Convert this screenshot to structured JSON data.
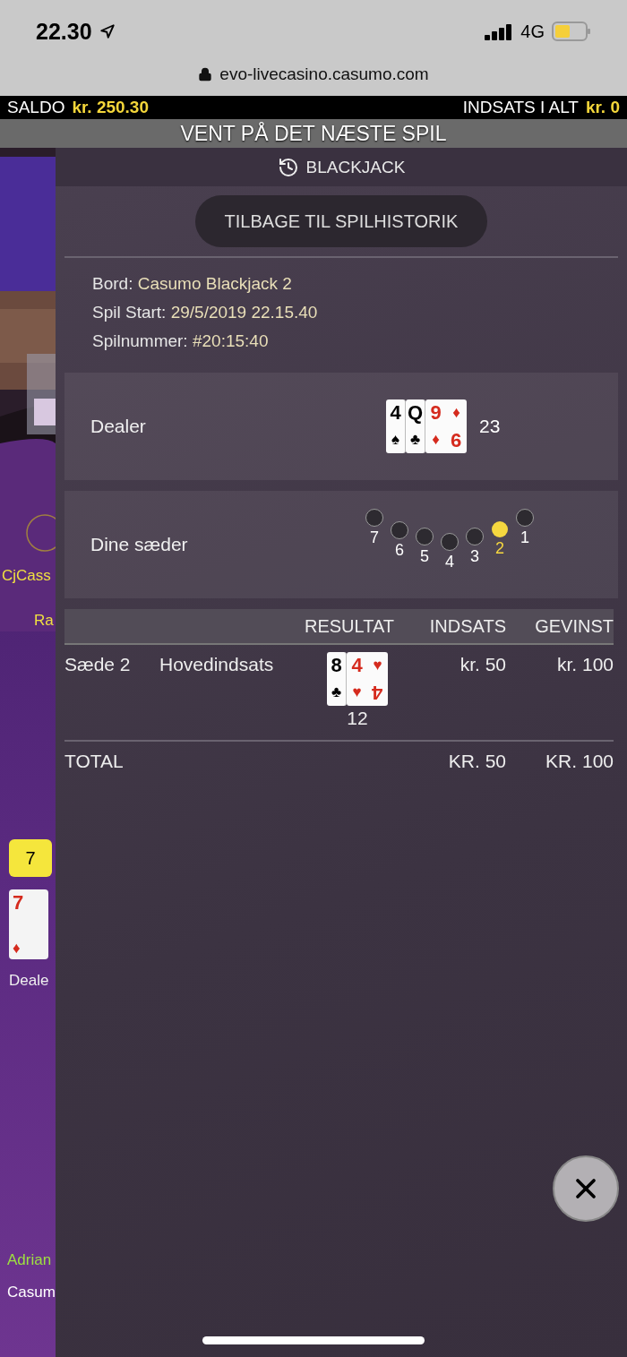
{
  "status_bar": {
    "time": "22.30",
    "network": "4G"
  },
  "browser": {
    "url": "evo-livecasino.casumo.com"
  },
  "balance_bar": {
    "balance_label": "SALDO",
    "balance": "kr. 250.30",
    "total_bet_label": "INDSATS I ALT",
    "total_bet": "kr. 0"
  },
  "banner": "VENT PÅ DET NÆSTE SPIL",
  "game_view": {
    "player_name": "CjCass",
    "player_line": "Ra",
    "dealer_score": "7",
    "dealer_card": {
      "rank": "7",
      "suit": "♦",
      "color": "#d52b1e"
    },
    "dealer_hand_label": "Deale",
    "chat_name": "Adrian",
    "table_name": "Casum"
  },
  "history": {
    "title": "BLACKJACK",
    "back_button": "TILBAGE TIL SPILHISTORIK",
    "details": [
      {
        "label": "Bord:",
        "value": "Casumo Blackjack 2"
      },
      {
        "label": "Spil Start:",
        "value": "29/5/2019 22.15.40"
      },
      {
        "label": "Spilnummer:",
        "value": "#20:15:40"
      }
    ],
    "dealer": {
      "label": "Dealer",
      "total": "23",
      "cards": [
        {
          "rank": "4",
          "suit": "♠",
          "color": "#000000"
        },
        {
          "rank": "Q",
          "suit": "♣",
          "color": "#000000"
        },
        {
          "rank": "9",
          "suit": "♦",
          "corner_suit": "♦",
          "corner_rank": "9",
          "color": "#d52b1e"
        }
      ]
    },
    "seats": {
      "label": "Dine sæder",
      "items": [
        {
          "number": "7",
          "selected": false
        },
        {
          "number": "6",
          "selected": false
        },
        {
          "number": "5",
          "selected": false
        },
        {
          "number": "4",
          "selected": false
        },
        {
          "number": "3",
          "selected": false
        },
        {
          "number": "2",
          "selected": true
        },
        {
          "number": "1",
          "selected": false
        }
      ]
    },
    "table": {
      "columns": [
        "RESULTAT",
        "INDSATS",
        "GEVINST"
      ],
      "rows": [
        {
          "seat": "Sæde 2",
          "bet_type": "Hovedindsats",
          "total": "12",
          "bet": "kr. 50",
          "win": "kr. 100",
          "cards": [
            {
              "rank": "8",
              "suit": "♣",
              "color": "#000000"
            },
            {
              "rank": "4",
              "suit": "♥",
              "corner_suit": "♥",
              "corner_rank": "4",
              "color": "#d52b1e"
            }
          ]
        }
      ],
      "total": {
        "label": "TOTAL",
        "bet": "KR. 50",
        "win": "KR. 100"
      }
    }
  }
}
